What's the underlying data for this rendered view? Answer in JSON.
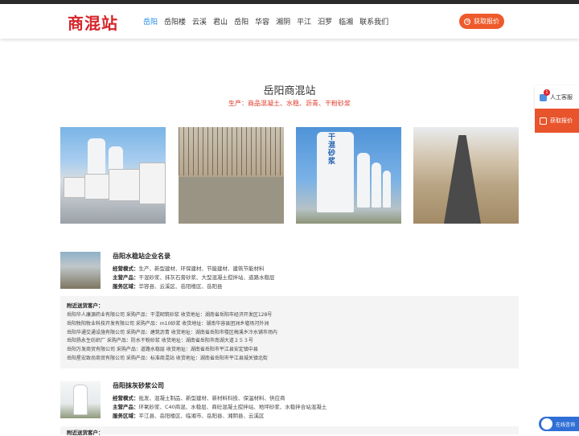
{
  "header": {
    "logo": "商混站",
    "nav": [
      "岳阳",
      "岳阳楼",
      "云溪",
      "君山",
      "岳阳",
      "华容",
      "湘阴",
      "平江",
      "汨罗",
      "临湘",
      "联系我们"
    ],
    "active_index": 0,
    "quote_button": "获取报价",
    "accent": "#ee5a2b",
    "brand_color": "#d6252b"
  },
  "hero": {
    "title": "岳阳商混站",
    "subtitle": "生产：商品混凝土、水稳、沥青、干粉砂浆"
  },
  "photos": {
    "silo_text": "干混砂浆"
  },
  "companies": [
    {
      "name": "岳阳水稳站企业名录",
      "mode_label": "经营模式：",
      "mode": "生产、新型建材、环保建材、节能建材、建筑节能材料",
      "products_label": "主营产品：",
      "products": "干混砂浆、抹灰石膏砂浆、大型混凝土搅拌站、道路水稳层",
      "area_label": "服务区域：",
      "area": "华容县、云溪区、岳阳楼区、岳阳县",
      "clients_title": "附近送货客户：",
      "clients": [
        "岳阳华人康源药业有限公司   采购产品：干混砌筑砂浆   收货地址：湖南省岳阳市经济开发区128号",
        "岳阳牧阳牧业科技开发有限公司   采购产品：m10砂浆   收货地址：湖南华容县团洲乡墟场河外洲",
        "岳阳华通交通设施有限公司   采购产品：建筑沥青   收货地址：湖南省岳阳市楼区梅溪乡冷水铺市场内",
        "岳阳扬永生纺织厂   采购产品：防水干粉砂浆   收货地址：湖南省岳阳市南湖大道２５３号",
        "岳阳万发商贸有限公司   采购产品：道路水稳层   收货地址：湖南省岳阳市平江县安定镇中县",
        "岳阳星宏致尚商贸有限公司   采购产品：标准商混站   收货地址：湖南省岳阳市平江县城关镇北街"
      ]
    },
    {
      "name": "岳阳抹灰砂浆公司",
      "mode_label": "经营模式：",
      "mode": "批发、混凝土制品、新型建材、新材料科技、保温材料、供应商",
      "products_label": "主营产品：",
      "products": "环氧砂浆、C40商混、水稳层、商砼混凝土搅拌站、地坪砂浆、水稳拌合站混凝土",
      "area_label": "服务区域：",
      "area": "平江县、岳阳楼区、临湘市、岳阳县、湘阴县、云溪区",
      "clients_title": "附近送货客户："
    }
  ],
  "side": {
    "service": "人工客服",
    "quote": "获取报价",
    "badge": "1",
    "chat": "在线咨询"
  }
}
